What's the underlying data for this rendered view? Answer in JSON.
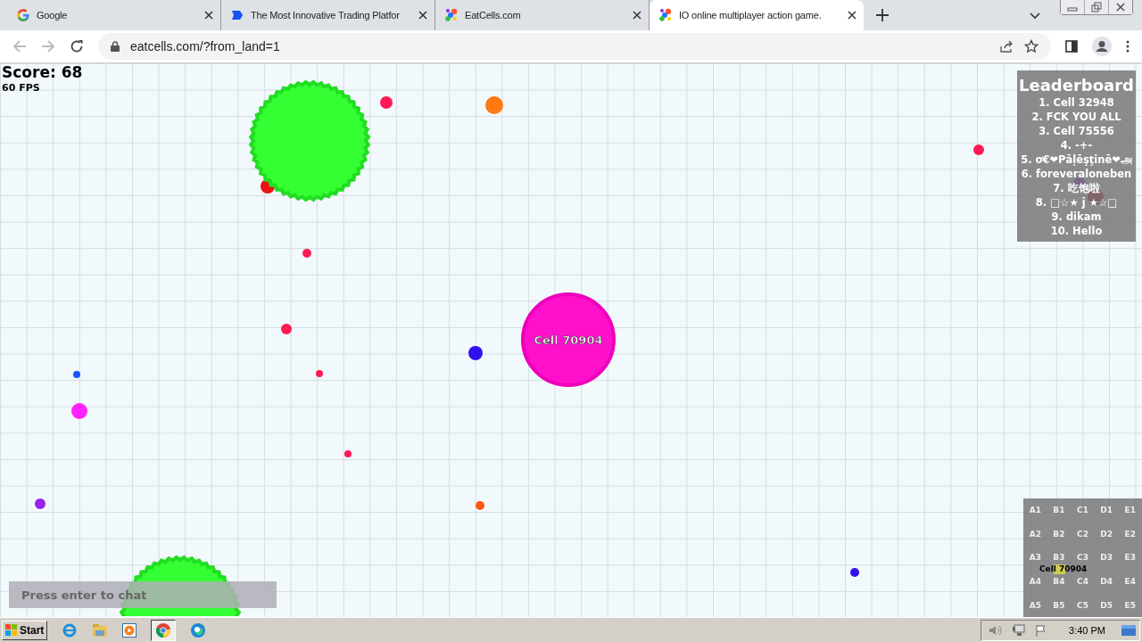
{
  "tabs": [
    {
      "title": "Google",
      "kind": "google",
      "selected": false
    },
    {
      "title": "The Most Innovative Trading Platfor",
      "kind": "trading",
      "selected": false
    },
    {
      "title": "EatCells.com",
      "kind": "cells",
      "selected": false
    },
    {
      "title": "IO online multiplayer action game.",
      "kind": "cells",
      "selected": true
    }
  ],
  "address_bar": {
    "url": "eatcells.com/?from_land=1"
  },
  "game": {
    "score": "Score: 68",
    "fps": "60 FPS",
    "player_name": "Cell 70904",
    "leaderboard": {
      "title": "Leaderboard",
      "entries": [
        "1. Cell 32948",
        "2. FCK YOU ALL",
        "3. Cell 75556",
        "4. -+-",
        "5. ơ€❤Pāļēşţinē❤அ",
        "6. foreveraloneben",
        "7. 吃饱啦",
        "8. □☆★ j ★☆□",
        "9. dikam",
        "10. Hello"
      ]
    },
    "minimap": {
      "rows": [
        [
          "A1",
          "B1",
          "C1",
          "D1",
          "E1"
        ],
        [
          "A2",
          "B2",
          "C2",
          "D2",
          "E2"
        ],
        [
          "A3",
          "B3",
          "C3",
          "D3",
          "E3"
        ],
        [
          "A4",
          "B4",
          "C4",
          "D4",
          "E4"
        ],
        [
          "A5",
          "B5",
          "C5",
          "D5",
          "E5"
        ]
      ],
      "player_label": "Cell 70904"
    },
    "chat": {
      "placeholder": "Press enter to chat"
    }
  },
  "taskbar": {
    "start": "Start",
    "clock": "3:40 PM"
  }
}
